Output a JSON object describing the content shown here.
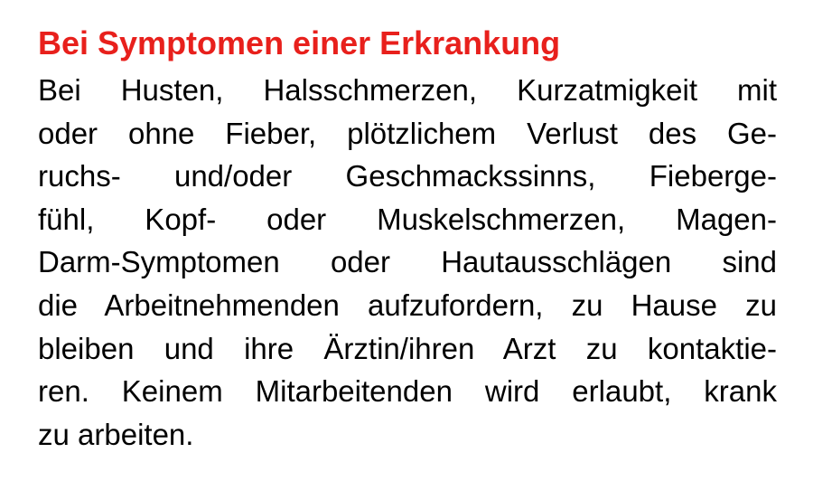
{
  "section": {
    "heading": "Bei Symptomen einer Erkrankung",
    "lines": [
      "Bei Husten, Halsschmerzen, Kurzatmigkeit mit",
      "oder ohne Fieber, plötzlichem Verlust des Ge-",
      "ruchs- und/oder Geschmackssinns, Fieberge-",
      "fühl, Kopf- oder Muskelschmerzen, Magen-",
      "Darm-Symptomen oder Hautausschlägen sind",
      "die Arbeitnehmenden aufzufordern, zu Hause zu",
      "bleiben und ihre Ärztin/ihren Arzt zu kontaktie-",
      "ren. Keinem Mitarbeitenden wird erlaubt, krank",
      "zu arbeiten."
    ]
  },
  "colors": {
    "heading": "#e8201c",
    "text": "#000000",
    "background": "#ffffff"
  }
}
